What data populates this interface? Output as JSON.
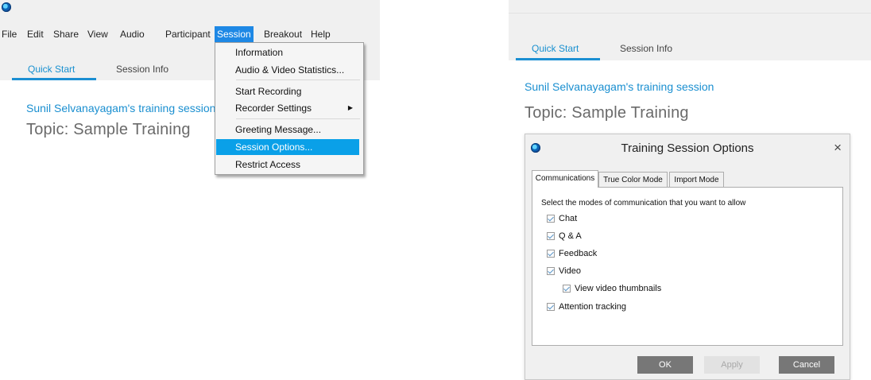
{
  "left": {
    "menu": [
      "File",
      "Edit",
      "Share",
      "View",
      "Audio",
      "Participant",
      "Session",
      "Breakout",
      "Help"
    ],
    "tabs": [
      "Quick Start",
      "Session Info"
    ],
    "session_title": "Sunil Selvanayagam's training session",
    "topic": "Topic: Sample Training",
    "dropdown": [
      "Information",
      "Audio & Video Statistics...",
      "Start Recording",
      "Recorder Settings",
      "Greeting Message...",
      "Session Options...",
      "Restrict Access"
    ]
  },
  "right": {
    "tabs": [
      "Quick Start",
      "Session Info"
    ],
    "session_title": "Sunil Selvanayagam's training session",
    "topic": "Topic: Sample Training",
    "dialog": {
      "title": "Training Session Options",
      "close": "×",
      "tabs": [
        "Communications",
        "True Color Mode",
        "Import Mode"
      ],
      "instruction": "Select the modes of communication that you want to allow",
      "options": [
        "Chat",
        "Q & A",
        "Feedback",
        "Video",
        "View video thumbnails",
        "Attention tracking"
      ],
      "buttons": {
        "ok": "OK",
        "apply": "Apply",
        "cancel": "Cancel"
      }
    }
  },
  "colors": {
    "accent": "#1b8fd2",
    "highlight": "#0aa0e8",
    "menu_active": "#1e88e5"
  }
}
